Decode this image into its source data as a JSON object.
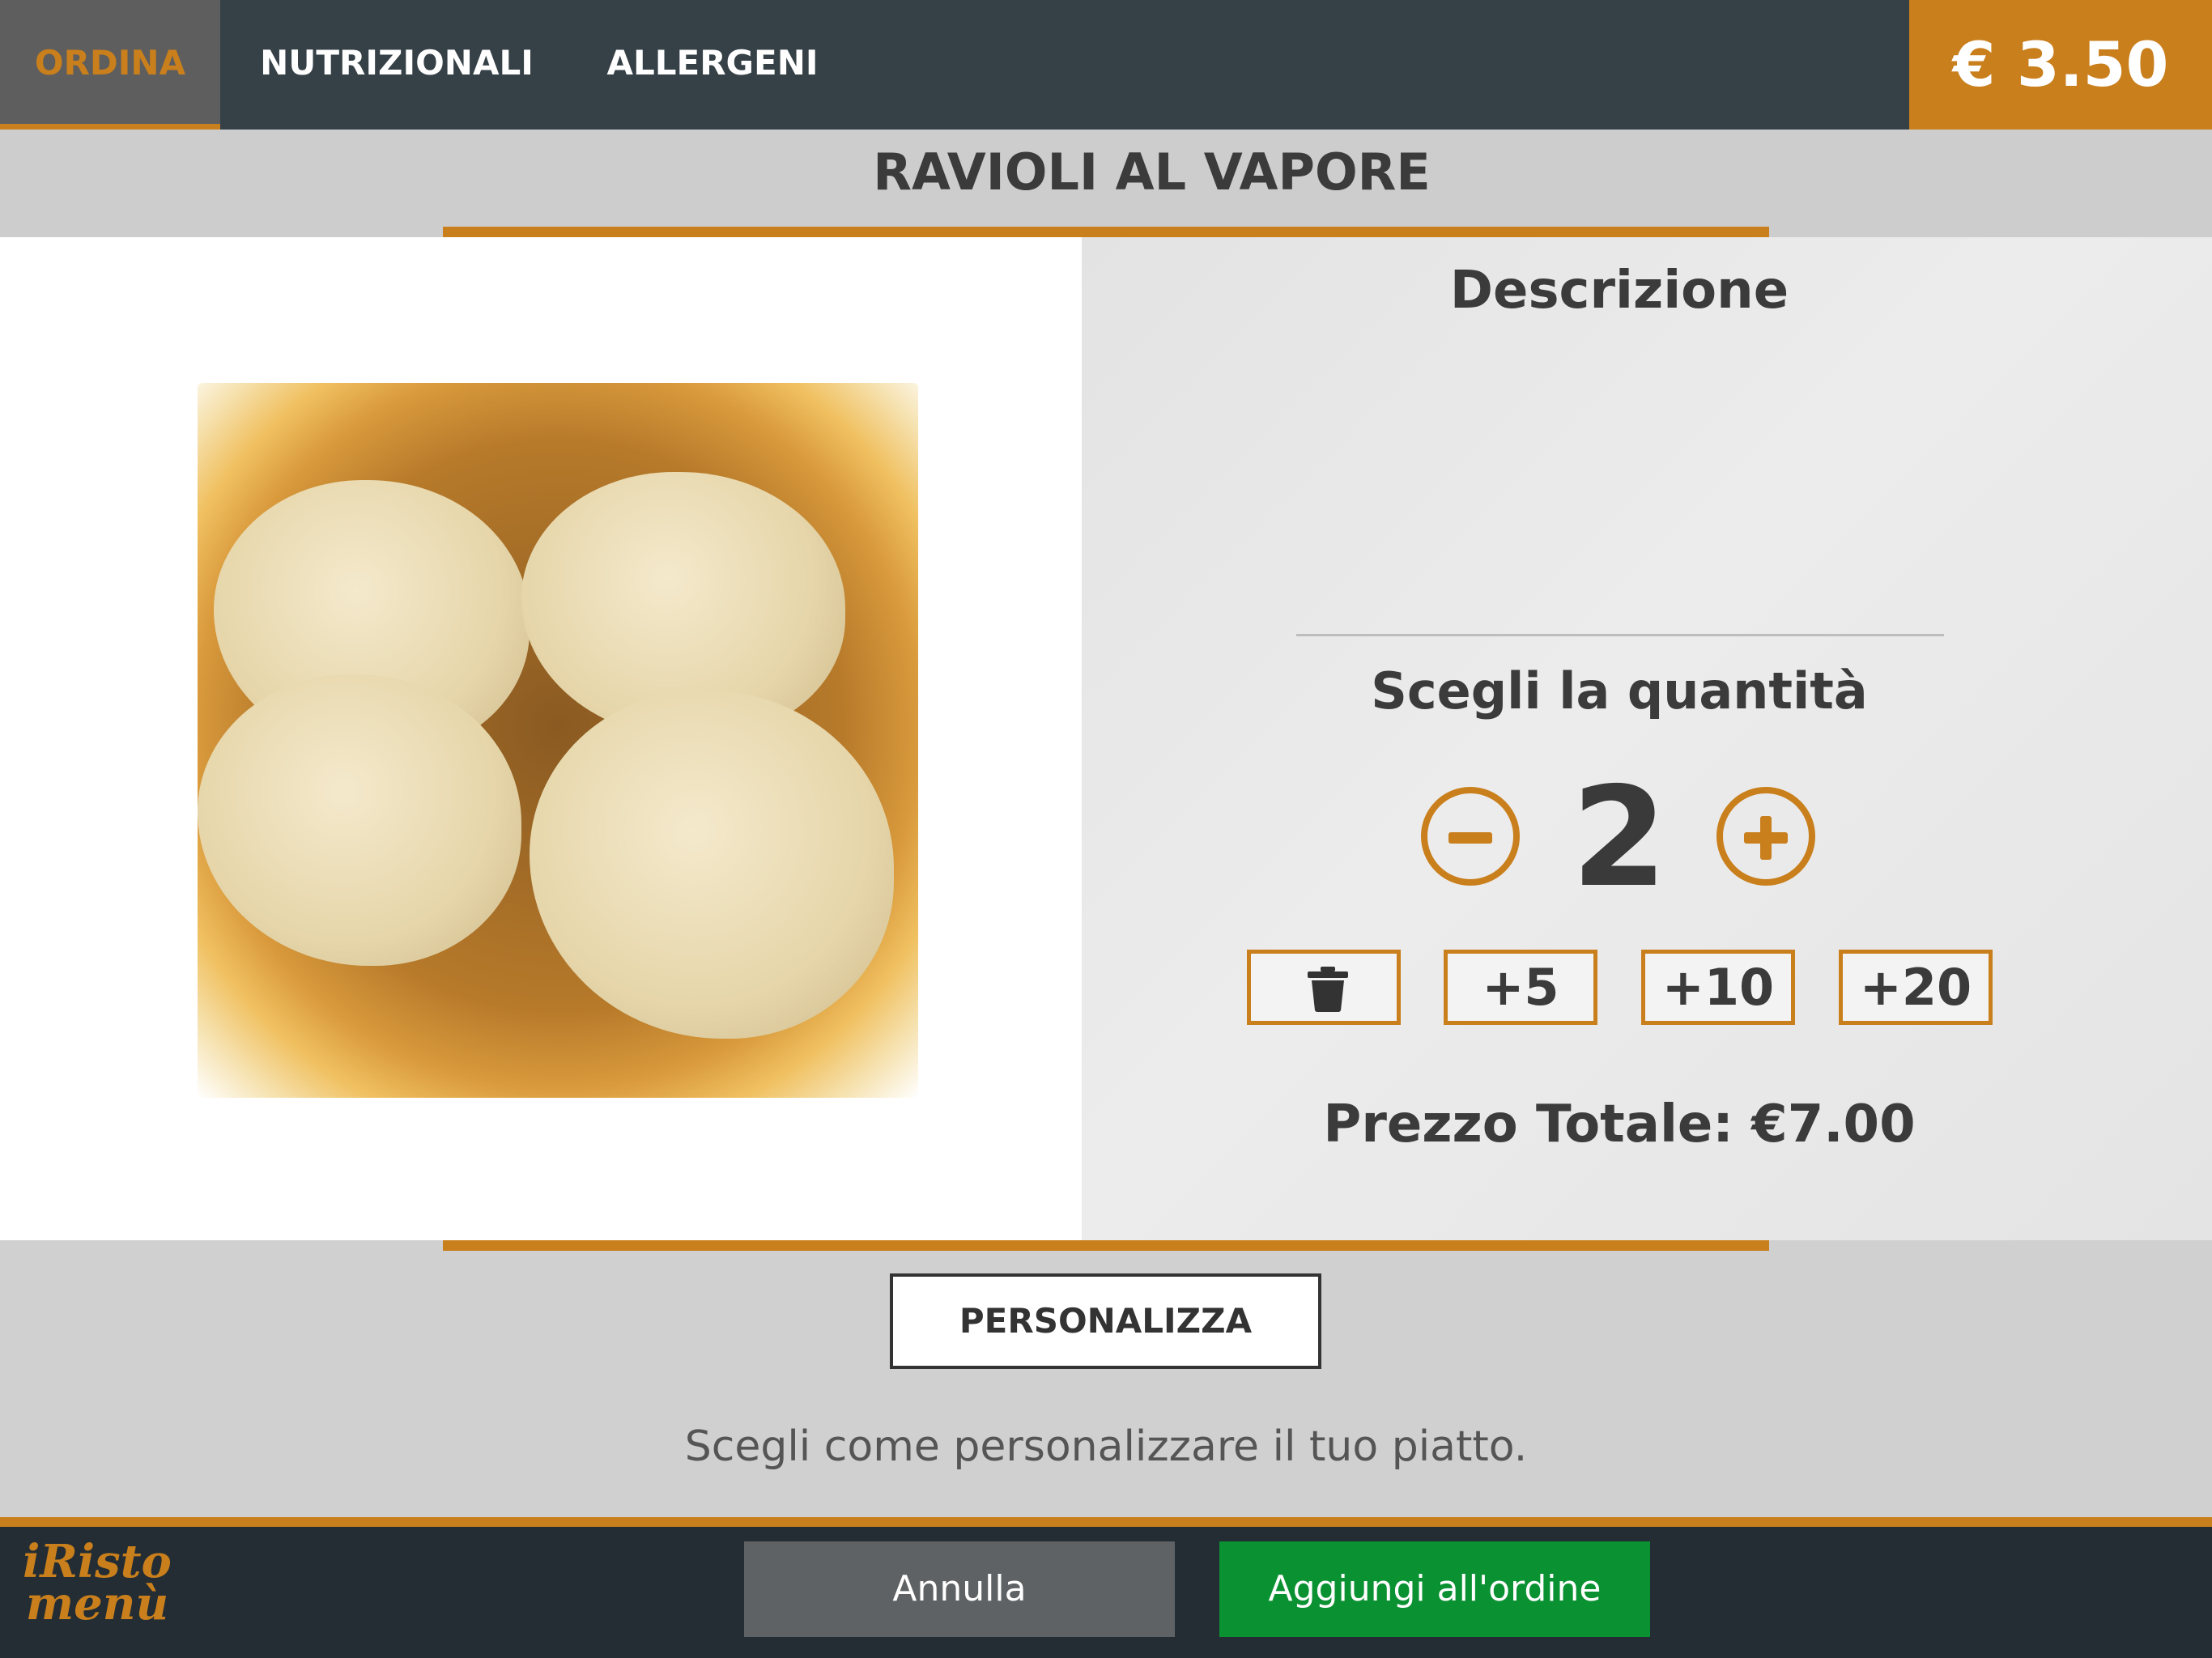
{
  "tabs": [
    {
      "label": "ORDINA",
      "active": true
    },
    {
      "label": "NUTRIZIONALI",
      "active": false
    },
    {
      "label": "ALLERGENI",
      "active": false
    }
  ],
  "unit_price": "€ 3.50",
  "dish": {
    "title": "RAVIOLI AL VAPORE",
    "image_icon": "dumplings-photo"
  },
  "description": {
    "title": "Descrizione",
    "text": ""
  },
  "quantity": {
    "label": "Scegli la quantità",
    "value": "2",
    "minus_icon": "minus-circle-icon",
    "plus_icon": "plus-circle-icon",
    "quick": [
      "+5",
      "+10",
      "+20"
    ],
    "clear_icon": "trash-icon"
  },
  "total": "Prezzo Totale: €7.00",
  "customize": {
    "button": "PERSONALIZZA",
    "hint": "Scegli come personalizzare il tuo piatto."
  },
  "footer": {
    "logo_line1": "iRisto",
    "logo_line2": "menù",
    "cancel": "Annulla",
    "add": "Aggiungi all'ordine"
  },
  "colors": {
    "accent": "#c97f1c",
    "topbar": "#354047",
    "bottombar": "#242d34",
    "add_button": "#0a9132",
    "cancel_button": "#5f6264"
  }
}
